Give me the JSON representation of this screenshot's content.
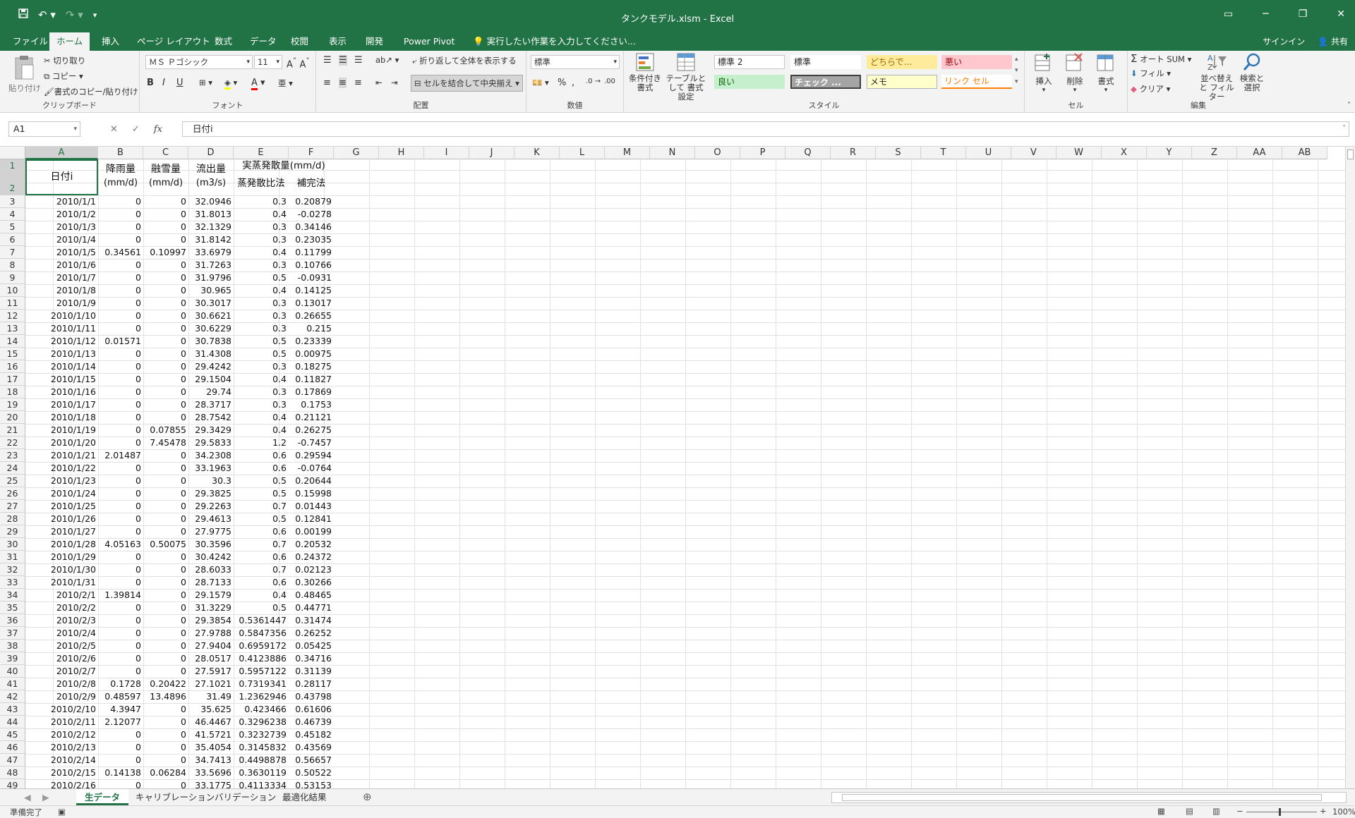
{
  "window": {
    "title": "タンクモデル.xlsm - Excel",
    "restore_icon": "restore-icon",
    "minimize": "─",
    "maximize": "❐",
    "close": "✕"
  },
  "qat": {
    "save": "save-icon",
    "undo": "undo-icon",
    "redo": "redo-icon",
    "customize": "customize-icon"
  },
  "tabs": [
    "ファイル",
    "ホーム",
    "挿入",
    "ページ レイアウト",
    "数式",
    "データ",
    "校閲",
    "表示",
    "開発",
    "Power Pivot"
  ],
  "active_tab": "ホーム",
  "tell_me": "実行したい作業を入力してください...",
  "signin": "サインイン",
  "share": "共有",
  "ribbon": {
    "clipboard": {
      "paste": "貼り付け",
      "cut": "切り取り",
      "copy": "コピー",
      "format_painter": "書式のコピー/貼り付け",
      "label": "クリップボード"
    },
    "font": {
      "name": "ＭＳ Ｐゴシック",
      "size": "11",
      "bold": "B",
      "italic": "I",
      "underline": "U",
      "label": "フォント"
    },
    "alignment": {
      "wrap": "折り返して全体を表示する",
      "merge": "セルを結合して中央揃え",
      "label": "配置"
    },
    "number": {
      "format": "標準",
      "percent": "%",
      "comma": ",",
      "label": "数値"
    },
    "styles": {
      "conditional": "条件付き 書式",
      "table": "テーブルとして 書式設定",
      "cells": [
        {
          "label": "標準 2",
          "bg": "#ffffff",
          "fg": "#222222"
        },
        {
          "label": "標準",
          "bg": "#ffffff",
          "fg": "#222222"
        },
        {
          "label": "どちらで...",
          "bg": "#ffeb9c",
          "fg": "#9c6500"
        },
        {
          "label": "悪い",
          "bg": "#ffc7ce",
          "fg": "#9c0006"
        },
        {
          "label": "良い",
          "bg": "#c6efce",
          "fg": "#006100"
        },
        {
          "label": "チェック ...",
          "bg": "#a5a5a5",
          "fg": "#ffffff"
        },
        {
          "label": "メモ",
          "bg": "#ffffcc",
          "fg": "#222222"
        },
        {
          "label": "リンク セル",
          "bg": "#ffffff",
          "fg": "#fa7d00"
        }
      ],
      "label": "スタイル"
    },
    "cells": {
      "insert": "挿入",
      "delete": "削除",
      "format": "書式",
      "label": "セル"
    },
    "editing": {
      "autosum": "オート SUM",
      "fill": "フィル",
      "clear": "クリア",
      "sort": "並べ替えと フィルター",
      "find": "検索と 選択",
      "label": "編集"
    }
  },
  "formula_bar": {
    "name_box": "A1",
    "fx": "fx",
    "cancel": "✕",
    "enter": "✓",
    "content": "日付i"
  },
  "columns": [
    "A",
    "B",
    "C",
    "D",
    "E",
    "F",
    "G",
    "H",
    "I",
    "J",
    "K",
    "L",
    "M",
    "N",
    "O",
    "P",
    "Q",
    "R",
    "S",
    "T",
    "U",
    "V",
    "W",
    "X",
    "Y",
    "Z",
    "AA",
    "AB"
  ],
  "headers": {
    "a": "日付i",
    "b1": "降雨量",
    "b2": "(mm/d)",
    "c1": "融雪量",
    "c2": "(mm/d)",
    "d1": "流出量",
    "d2": "(m3/s)",
    "ef1": "実蒸発散量(mm/d)",
    "e2": "蒸発散比法",
    "f2": "補完法"
  },
  "rows": [
    [
      "2010/1/1",
      "0",
      "0",
      "32.0946",
      "0.3",
      "0.20879"
    ],
    [
      "2010/1/2",
      "0",
      "0",
      "31.8013",
      "0.4",
      "-0.0278"
    ],
    [
      "2010/1/3",
      "0",
      "0",
      "32.1329",
      "0.3",
      "0.34146"
    ],
    [
      "2010/1/4",
      "0",
      "0",
      "31.8142",
      "0.3",
      "0.23035"
    ],
    [
      "2010/1/5",
      "0.34561",
      "0.10997",
      "33.6979",
      "0.4",
      "0.11799"
    ],
    [
      "2010/1/6",
      "0",
      "0",
      "31.7263",
      "0.3",
      "0.10766"
    ],
    [
      "2010/1/7",
      "0",
      "0",
      "31.9796",
      "0.5",
      "-0.0931"
    ],
    [
      "2010/1/8",
      "0",
      "0",
      "30.965",
      "0.4",
      "0.14125"
    ],
    [
      "2010/1/9",
      "0",
      "0",
      "30.3017",
      "0.3",
      "0.13017"
    ],
    [
      "2010/1/10",
      "0",
      "0",
      "30.6621",
      "0.3",
      "0.26655"
    ],
    [
      "2010/1/11",
      "0",
      "0",
      "30.6229",
      "0.3",
      "0.215"
    ],
    [
      "2010/1/12",
      "0.01571",
      "0",
      "30.7838",
      "0.5",
      "0.23339"
    ],
    [
      "2010/1/13",
      "0",
      "0",
      "31.4308",
      "0.5",
      "0.00975"
    ],
    [
      "2010/1/14",
      "0",
      "0",
      "29.4242",
      "0.3",
      "0.18275"
    ],
    [
      "2010/1/15",
      "0",
      "0",
      "29.1504",
      "0.4",
      "0.11827"
    ],
    [
      "2010/1/16",
      "0",
      "0",
      "29.74",
      "0.3",
      "0.17869"
    ],
    [
      "2010/1/17",
      "0",
      "0",
      "28.3717",
      "0.3",
      "0.1753"
    ],
    [
      "2010/1/18",
      "0",
      "0",
      "28.7542",
      "0.4",
      "0.21121"
    ],
    [
      "2010/1/19",
      "0",
      "0.07855",
      "29.3429",
      "0.4",
      "0.26275"
    ],
    [
      "2010/1/20",
      "0",
      "7.45478",
      "29.5833",
      "1.2",
      "-0.7457"
    ],
    [
      "2010/1/21",
      "2.01487",
      "0",
      "34.2308",
      "0.6",
      "0.29594"
    ],
    [
      "2010/1/22",
      "0",
      "0",
      "33.1963",
      "0.6",
      "-0.0764"
    ],
    [
      "2010/1/23",
      "0",
      "0",
      "30.3",
      "0.5",
      "0.20644"
    ],
    [
      "2010/1/24",
      "0",
      "0",
      "29.3825",
      "0.5",
      "0.15998"
    ],
    [
      "2010/1/25",
      "0",
      "0",
      "29.2263",
      "0.7",
      "0.01443"
    ],
    [
      "2010/1/26",
      "0",
      "0",
      "29.4613",
      "0.5",
      "0.12841"
    ],
    [
      "2010/1/27",
      "0",
      "0",
      "27.9775",
      "0.6",
      "0.00199"
    ],
    [
      "2010/1/28",
      "4.05163",
      "0.50075",
      "30.3596",
      "0.7",
      "0.20532"
    ],
    [
      "2010/1/29",
      "0",
      "0",
      "30.4242",
      "0.6",
      "0.24372"
    ],
    [
      "2010/1/30",
      "0",
      "0",
      "28.6033",
      "0.7",
      "0.02123"
    ],
    [
      "2010/1/31",
      "0",
      "0",
      "28.7133",
      "0.6",
      "0.30266"
    ],
    [
      "2010/2/1",
      "1.39814",
      "0",
      "29.1579",
      "0.4",
      "0.48465"
    ],
    [
      "2010/2/2",
      "0",
      "0",
      "31.3229",
      "0.5",
      "0.44771"
    ],
    [
      "2010/2/3",
      "0",
      "0",
      "29.3854",
      "0.5361447",
      "0.31474"
    ],
    [
      "2010/2/4",
      "0",
      "0",
      "27.9788",
      "0.5847356",
      "0.26252"
    ],
    [
      "2010/2/5",
      "0",
      "0",
      "27.9404",
      "0.6959172",
      "0.05425"
    ],
    [
      "2010/2/6",
      "0",
      "0",
      "28.0517",
      "0.4123886",
      "0.34716"
    ],
    [
      "2010/2/7",
      "0",
      "0",
      "27.5917",
      "0.5957122",
      "0.31139"
    ],
    [
      "2010/2/8",
      "0.1728",
      "0.20422",
      "27.1021",
      "0.7319341",
      "0.28117"
    ],
    [
      "2010/2/9",
      "0.48597",
      "13.4896",
      "31.49",
      "1.2362946",
      "0.43798"
    ],
    [
      "2010/2/10",
      "4.3947",
      "0",
      "35.625",
      "0.423466",
      "0.61606"
    ],
    [
      "2010/2/11",
      "2.12077",
      "0",
      "46.4467",
      "0.3296238",
      "0.46739"
    ],
    [
      "2010/2/12",
      "0",
      "0",
      "41.5721",
      "0.3232739",
      "0.45182"
    ],
    [
      "2010/2/13",
      "0",
      "0",
      "35.4054",
      "0.3145832",
      "0.43569"
    ],
    [
      "2010/2/14",
      "0",
      "0",
      "34.7413",
      "0.4498878",
      "0.56657"
    ],
    [
      "2010/2/15",
      "0.14138",
      "0.06284",
      "33.5696",
      "0.3630119",
      "0.50522"
    ],
    [
      "2010/2/16",
      "0",
      "0",
      "33.1775",
      "0.4113334",
      "0.53153"
    ]
  ],
  "sheets": [
    "生データ",
    "キャリブレーション",
    "バリデーション",
    "最適化結果"
  ],
  "active_sheet": "生データ",
  "status": {
    "ready": "準備完了",
    "zoom": "100%"
  }
}
